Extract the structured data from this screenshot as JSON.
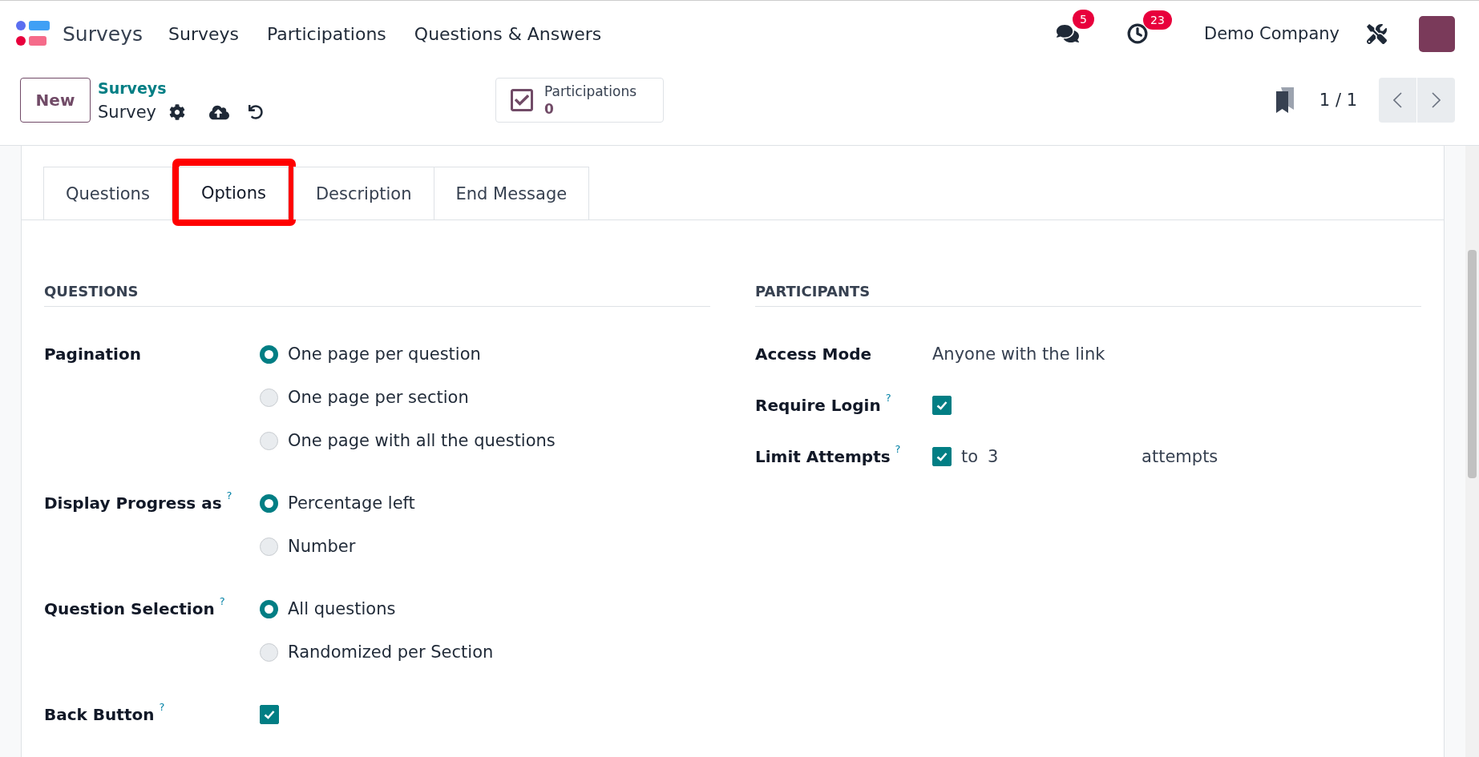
{
  "navbar": {
    "app_name": "Surveys",
    "menu": [
      {
        "label": "Surveys"
      },
      {
        "label": "Participations"
      },
      {
        "label": "Questions & Answers"
      }
    ],
    "messages_badge": "5",
    "activities_badge": "23",
    "company": "Demo Company"
  },
  "control_panel": {
    "new_button": "New",
    "breadcrumb_parent": "Surveys",
    "breadcrumb_current": "Survey",
    "stat_button": {
      "label": "Participations",
      "value": "0"
    },
    "pager": "1 / 1"
  },
  "tabs": [
    {
      "label": "Questions",
      "selected": false,
      "highlighted": false
    },
    {
      "label": "Options",
      "selected": true,
      "highlighted": true
    },
    {
      "label": "Description",
      "selected": false,
      "highlighted": false
    },
    {
      "label": "End Message",
      "selected": false,
      "highlighted": false
    }
  ],
  "sections": [
    {
      "title": "QUESTIONS",
      "fields": [
        {
          "kind": "radio",
          "label": "Pagination",
          "options": [
            {
              "label": "One page per question",
              "selected": true
            },
            {
              "label": "One page per section",
              "selected": false
            },
            {
              "label": "One page with all the questions",
              "selected": false
            }
          ]
        },
        {
          "kind": "radio",
          "label": "Display Progress as",
          "help": "?",
          "options": [
            {
              "label": "Percentage left",
              "selected": true
            },
            {
              "label": "Number",
              "selected": false
            }
          ]
        },
        {
          "kind": "radio",
          "label": "Question Selection",
          "help": "?",
          "options": [
            {
              "label": "All questions",
              "selected": true
            },
            {
              "label": "Randomized per Section",
              "selected": false
            }
          ]
        },
        {
          "kind": "checkbox",
          "label": "Back Button",
          "help": "?",
          "checked": true
        }
      ]
    },
    {
      "title": "PARTICIPANTS",
      "fields": [
        {
          "kind": "text",
          "label": "Access Mode",
          "value": "Anyone with the link"
        },
        {
          "kind": "checkbox",
          "label": "Require Login",
          "help": "?",
          "checked": true
        },
        {
          "kind": "limit",
          "label": "Limit Attempts",
          "help": "?",
          "checked": true,
          "prefix": "to",
          "value": "3",
          "suffix": "attempts"
        }
      ]
    }
  ]
}
